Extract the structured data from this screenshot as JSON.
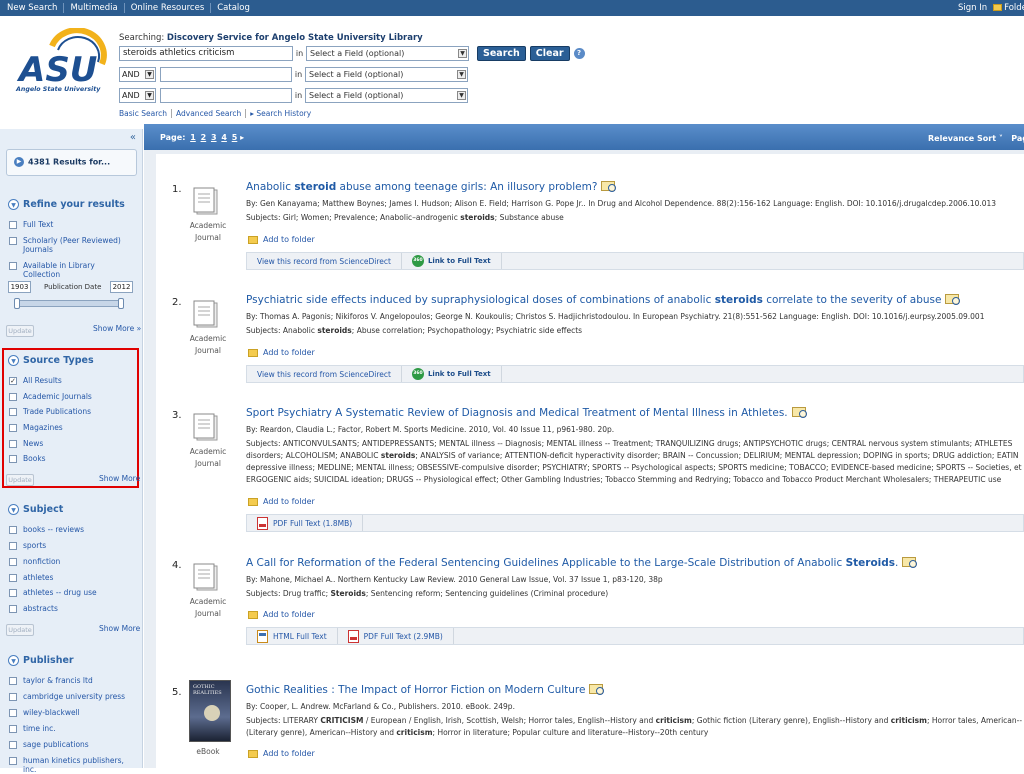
{
  "topbar": {
    "nav": [
      "New Search",
      "Multimedia",
      "Online Resources",
      "Catalog"
    ],
    "sign_in": "Sign In",
    "folder": "Folde"
  },
  "logo": {
    "text": "ASU",
    "subtitle": "Angelo State University"
  },
  "search": {
    "searching_label": "Searching:",
    "searching_target": "Discovery Service for Angelo State University Library",
    "query": "steroids athletics criticism",
    "in_label": "in",
    "field_placeholder": "Select a Field (optional)",
    "and_label": "AND",
    "search_button": "Search",
    "clear_button": "Clear",
    "help": "?",
    "links": [
      "Basic Search",
      "Advanced Search",
      "▸ Search History"
    ]
  },
  "sidebar": {
    "collapse": "«",
    "results_for": "4381 Results for...",
    "refine_title": "Refine your results",
    "refine_items": [
      "Full Text",
      "Scholarly (Peer Reviewed) Journals",
      "Available in Library Collection"
    ],
    "year_from": "1903",
    "year_to": "2012",
    "pub_date_label": "Publication Date",
    "update": "Update",
    "show_more_arrow": "Show More »",
    "show_more": "Show More",
    "source_title": "Source Types",
    "source_items": [
      "All Results",
      "Academic Journals",
      "Trade Publications",
      "Magazines",
      "News",
      "Books"
    ],
    "subject_title": "Subject",
    "subject_items": [
      "books -- reviews",
      "sports",
      "nonfiction",
      "athletes",
      "athletes -- drug use",
      "abstracts"
    ],
    "publisher_title": "Publisher",
    "publisher_items": [
      "taylor & francis ltd",
      "cambridge university press",
      "wiley-blackwell",
      "time inc.",
      "sage publications",
      "human kinetics publishers, inc."
    ]
  },
  "pagebar": {
    "page_label": "Page:",
    "pages": [
      "1",
      "2",
      "3",
      "4",
      "5"
    ],
    "next": "▸",
    "sort": "Relevance Sort ˅",
    "page_options": "Page"
  },
  "common": {
    "add_to_folder": "Add to folder"
  },
  "results": [
    {
      "num": "1.",
      "type": [
        "Academic",
        "Journal"
      ],
      "title_pre": "Anabolic ",
      "title_hl": "steroid",
      "title_post": " abuse among teenage girls: An illusory problem?",
      "meta": "By: Gen Kanayama; Matthew Boynes; James I. Hudson; Alison E. Field; Harrison G. Pope Jr.. In Drug and Alcohol Dependence. 88(2):156-162 Language: English. DOI: 10.1016/j.drugalcdep.2006.10.013",
      "subjects_pre": "Subjects: Girl; Women; Prevalence; Anabolic–androgenic ",
      "subjects_hl": "steroids",
      "subjects_post": "; Substance abuse",
      "link1": "View this record from ScienceDirect",
      "link2": "Link to Full Text"
    },
    {
      "num": "2.",
      "type": [
        "Academic",
        "Journal"
      ],
      "title_pre": "Psychiatric side effects induced by supraphysiological doses of combinations of anabolic ",
      "title_hl": "steroids",
      "title_post": " correlate to the severity of abuse",
      "meta": "By: Thomas A. Pagonis; Nikiforos V. Angelopoulos; George N. Koukoulis; Christos S. Hadjichristodoulou. In European Psychiatry. 21(8):551-562 Language: English. DOI: 10.1016/j.eurpsy.2005.09.001",
      "subjects_pre": "Subjects: Anabolic ",
      "subjects_hl": "steroids",
      "subjects_post": "; Abuse correlation; Psychopathology; Psychiatric side effects",
      "link1": "View this record from ScienceDirect",
      "link2": "Link to Full Text"
    },
    {
      "num": "3.",
      "type": [
        "Academic",
        "Journal"
      ],
      "title": "Sport Psychiatry A Systematic Review of Diagnosis and Medical Treatment of Mental Illness in Athletes.",
      "meta": "By: Reardon, Claudia L.; Factor, Robert M. Sports Medicine. 2010, Vol. 40 Issue 11, p961-980. 20p.",
      "subj_l1": "Subjects: ANTICONVULSANTS; ANTIDEPRESSANTS; MENTAL illness -- Diagnosis; MENTAL illness -- Treatment; TRANQUILIZING drugs; ANTIPSYCHOTIC drugs; CENTRAL nervous system stimulants; ATHLETES",
      "subj_l2_pre": "disorders; ALCOHOLISM; ANABOLIC ",
      "subj_l2_hl": "steroids",
      "subj_l2_post": "; ANALYSIS of variance; ATTENTION-deficit hyperactivity disorder; BRAIN -- Concussion; DELIRIUM; MENTAL depression; DOPING in sports; DRUG addiction; EATIN",
      "subj_l3": "depressive illness; MEDLINE; MENTAL illness; OBSESSIVE-compulsive disorder; PSYCHIATRY; SPORTS -- Psychological aspects; SPORTS medicine; TOBACCO; EVIDENCE-based medicine; SPORTS -- Societies, et",
      "subj_l4": "ERGOGENIC aids; SUICIDAL ideation; DRUGS -- Physiological effect; Other Gambling Industries; Tobacco Stemming and Redrying; Tobacco and Tobacco Product Merchant Wholesalers; THERAPEUTIC use",
      "link1": "PDF Full Text (1.8MB)"
    },
    {
      "num": "4.",
      "type": [
        "Academic",
        "Journal"
      ],
      "title_pre": "A Call for Reformation of the Federal Sentencing Guidelines Applicable to the Large-Scale Distribution of Anabolic ",
      "title_hl": "Steroids",
      "title_post": ".",
      "meta": "By: Mahone, Michael A.. Northern Kentucky Law Review. 2010 General Law Issue, Vol. 37 Issue 1, p83-120, 38p",
      "subjects_pre": "Subjects: Drug traffic; ",
      "subjects_hl": "Steroids",
      "subjects_post": "; Sentencing reform; Sentencing guidelines (Criminal procedure)",
      "link1": "HTML Full Text",
      "link2": "PDF Full Text (2.9MB)"
    },
    {
      "num": "5.",
      "type": [
        "eBook"
      ],
      "cover_text": "GOTHIC REALITIES",
      "title": "Gothic Realities : The Impact of Horror Fiction on Modern Culture",
      "meta": "By: Cooper, L. Andrew. McFarland & Co., Publishers. 2010. eBook. 249p.",
      "s1": "Subjects: LITERARY ",
      "s1hl": "CRITICISM",
      "s2": " / European / English, Irish, Scottish, Welsh; Horror tales, English--History and ",
      "s2hl": "criticism",
      "s3": "; Gothic fiction (Literary genre), English--History and ",
      "s3hl": "criticism",
      "s4": "; Horror tales, American--",
      "l2a": "(Literary genre), American--History and ",
      "l2hl": "criticism",
      "l2b": "; Horror in literature; Popular culture and literature--History--20th century"
    }
  ],
  "colors": {
    "topbar": "#2c5c8f",
    "link": "#1f5aa6",
    "sidebar": "#e6eef7",
    "highlight_box": "#e00000",
    "pagebar": "#4c83c2"
  }
}
